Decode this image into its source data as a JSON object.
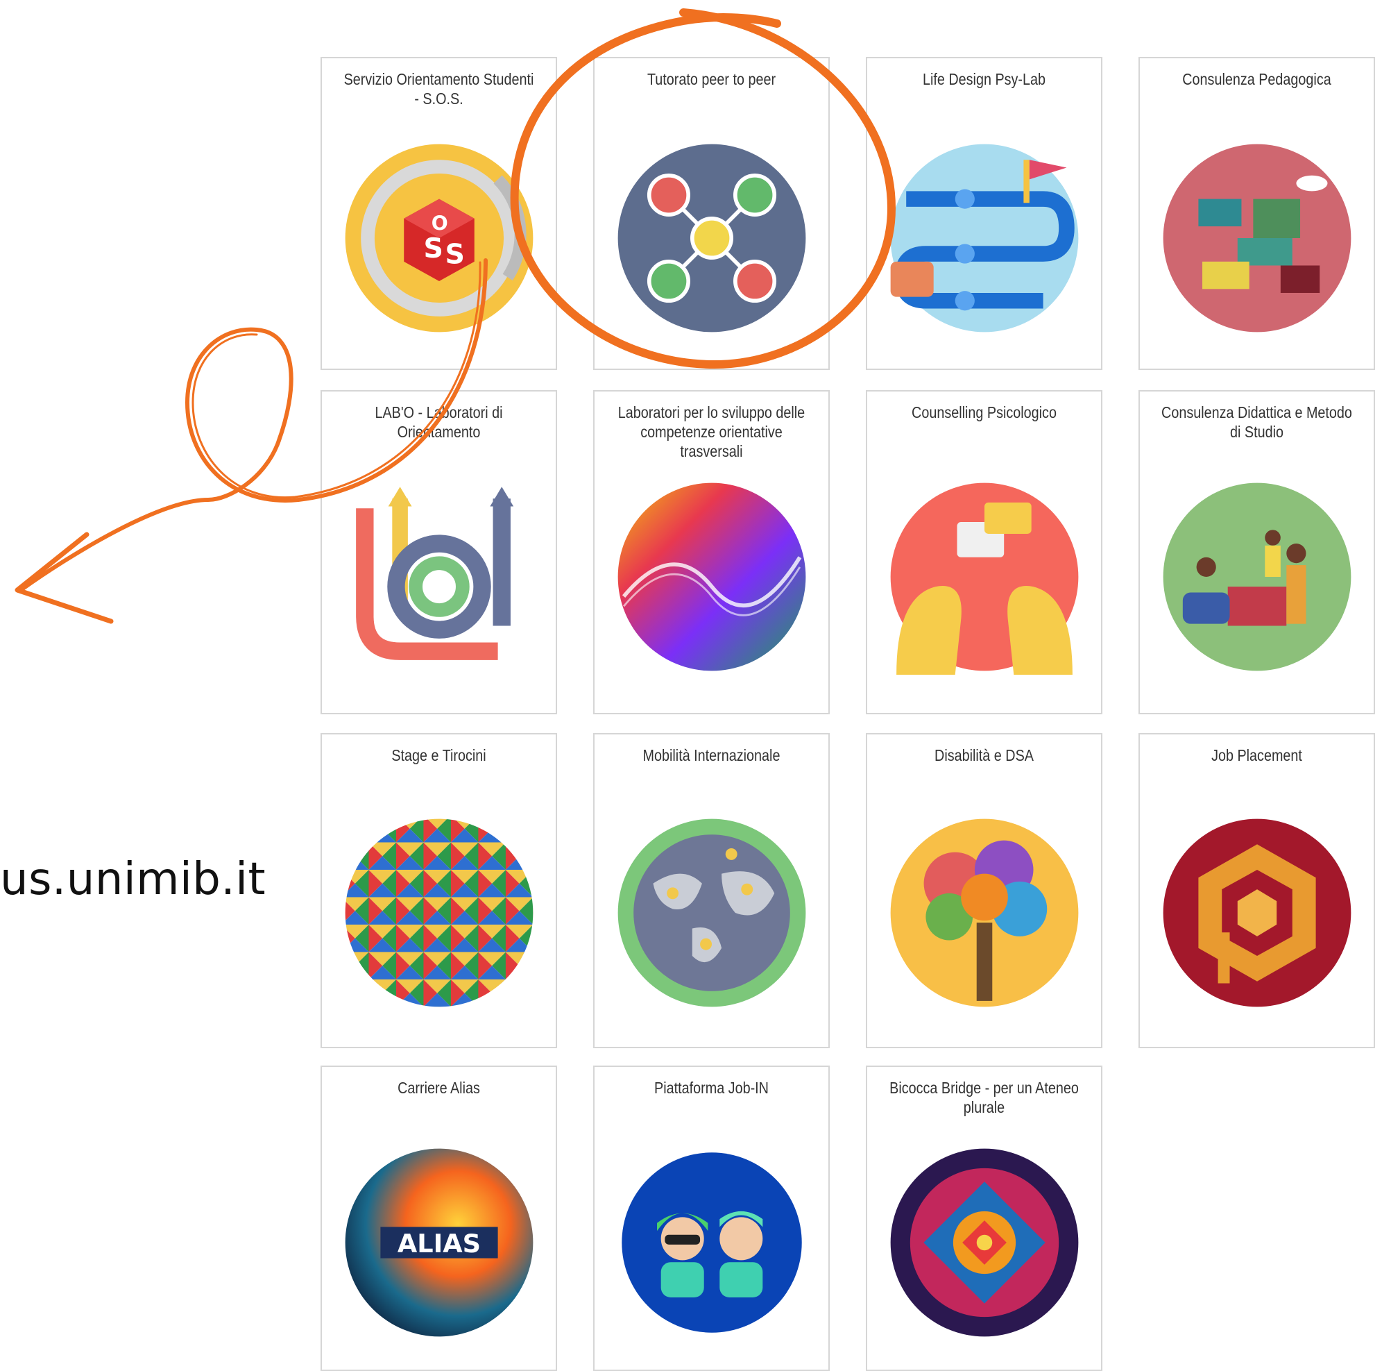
{
  "side_text": "us.unimib.it",
  "accent_color": "#f07020",
  "cards": [
    {
      "title": "Servizio Orientamento Studenti - S.O.S.",
      "icon": "sos-badge-icon"
    },
    {
      "title": "Tutorato peer to peer",
      "icon": "peer-network-icon"
    },
    {
      "title": "Life Design Psy-Lab",
      "icon": "path-roadmap-icon"
    },
    {
      "title": "Consulenza Pedagogica",
      "icon": "lego-blocks-icon"
    },
    {
      "title": "LAB'O - Laboratori di Orientamento",
      "icon": "labo-logo-icon"
    },
    {
      "title": "Laboratori per lo sviluppo delle competenze orientative trasversali",
      "icon": "color-wave-icon"
    },
    {
      "title": "Counselling Psicologico",
      "icon": "dialogue-heads-icon"
    },
    {
      "title": "Consulenza Didattica e Metodo di Studio",
      "icon": "study-people-icon"
    },
    {
      "title": "Stage e Tirocini",
      "icon": "geometric-pattern-icon"
    },
    {
      "title": "Mobilità Internazionale",
      "icon": "globe-people-icon"
    },
    {
      "title": "Disabilità e DSA",
      "icon": "puzzle-tree-icon"
    },
    {
      "title": "Job Placement",
      "icon": "cube-logo-icon"
    },
    {
      "title": "Carriere Alias",
      "icon": "alias-art-icon",
      "badge": "ALIAS"
    },
    {
      "title": "Piattaforma Job-IN",
      "icon": "avatars-icon"
    },
    {
      "title": "Bicocca Bridge - per un Ateneo plurale",
      "icon": "mandala-icon"
    }
  ]
}
